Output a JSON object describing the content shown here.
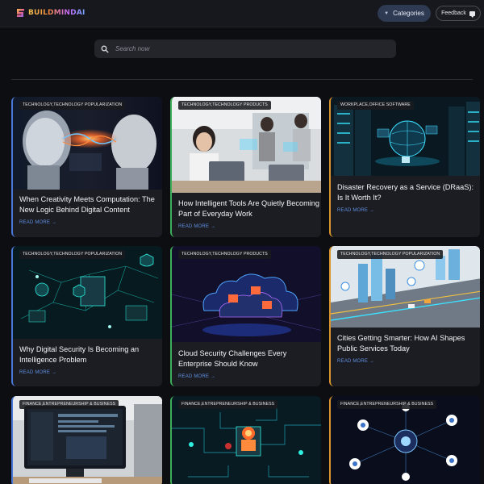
{
  "header": {
    "logo_text": "BUILDMINDAI",
    "categories_label": "Categories",
    "feedback_label": "Feedback"
  },
  "search": {
    "placeholder": "Search now",
    "value": ""
  },
  "colors": {
    "background": "#0d0e12",
    "header": "#17181d",
    "card": "#1c1d22",
    "categories_button": "#2e3a52",
    "read_more": "#5f8ee0",
    "accent_blue": "#4a78d8",
    "accent_green": "#3fae5a",
    "accent_orange": "#d9942e"
  },
  "cards": [
    {
      "tag": "TECHNOLOGY,TECHNOLOGY POPULARIZATION",
      "title": "When Creativity Meets Computation: The New Logic Behind Digital Content",
      "read_more": "READ MORE →",
      "accent": "blue",
      "image": "robot-faces-energy-icon"
    },
    {
      "tag": "TECHNOLOGY,TECHNOLOGY PRODUCTS",
      "title": "How Intelligent Tools Are Quietly Becoming Part of Everyday Work",
      "read_more": "READ MORE →",
      "accent": "green",
      "image": "office-workers-laptop-icon"
    },
    {
      "tag": "WORKPLACE,OFFICE SOFTWARE",
      "title": "Disaster Recovery as a Service (DRaaS): Is It Worth It?",
      "read_more": "READ MORE →",
      "accent": "orange",
      "image": "server-room-globe-icon"
    },
    {
      "tag": "TECHNOLOGY,TECHNOLOGY POPULARIZATION",
      "title": "Why Digital Security Is Becoming an Intelligence Problem",
      "read_more": "READ MORE →",
      "accent": "blue",
      "image": "security-shield-network-icon"
    },
    {
      "tag": "TECHNOLOGY,TECHNOLOGY PRODUCTS",
      "title": "Cloud Security Challenges Every Enterprise Should Know",
      "read_more": "READ MORE →",
      "accent": "green",
      "image": "cloud-security-icon"
    },
    {
      "tag": "TECHNOLOGY,TECHNOLOGY POPULARIZATION",
      "title": "Cities Getting Smarter: How AI Shapes Public Services Today",
      "read_more": "READ MORE →",
      "accent": "orange",
      "image": "smart-city-icon"
    },
    {
      "tag": "FINANCE,ENTREPRENEURSHIP & BUSINESS",
      "title": "",
      "read_more": "",
      "accent": "blue",
      "image": "desktop-monitor-icon"
    },
    {
      "tag": "FINANCE,ENTREPRENEURSHIP & BUSINESS",
      "title": "",
      "read_more": "",
      "accent": "green",
      "image": "circuit-board-icon"
    },
    {
      "tag": "FINANCE,ENTREPRENEURSHIP & BUSINESS",
      "title": "",
      "read_more": "",
      "accent": "orange",
      "image": "data-network-icon"
    }
  ]
}
